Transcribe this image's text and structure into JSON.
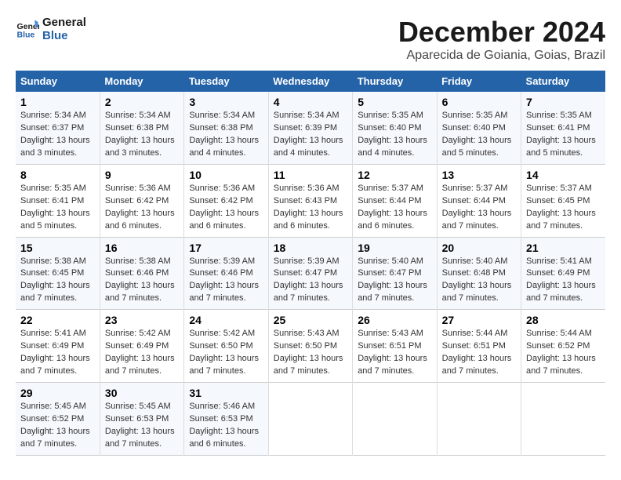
{
  "logo": {
    "line1": "General",
    "line2": "Blue"
  },
  "title": "December 2024",
  "subtitle": "Aparecida de Goiania, Goias, Brazil",
  "days_header": [
    "Sunday",
    "Monday",
    "Tuesday",
    "Wednesday",
    "Thursday",
    "Friday",
    "Saturday"
  ],
  "weeks": [
    [
      {
        "day": "1",
        "info": "Sunrise: 5:34 AM\nSunset: 6:37 PM\nDaylight: 13 hours\nand 3 minutes."
      },
      {
        "day": "2",
        "info": "Sunrise: 5:34 AM\nSunset: 6:38 PM\nDaylight: 13 hours\nand 3 minutes."
      },
      {
        "day": "3",
        "info": "Sunrise: 5:34 AM\nSunset: 6:38 PM\nDaylight: 13 hours\nand 4 minutes."
      },
      {
        "day": "4",
        "info": "Sunrise: 5:34 AM\nSunset: 6:39 PM\nDaylight: 13 hours\nand 4 minutes."
      },
      {
        "day": "5",
        "info": "Sunrise: 5:35 AM\nSunset: 6:40 PM\nDaylight: 13 hours\nand 4 minutes."
      },
      {
        "day": "6",
        "info": "Sunrise: 5:35 AM\nSunset: 6:40 PM\nDaylight: 13 hours\nand 5 minutes."
      },
      {
        "day": "7",
        "info": "Sunrise: 5:35 AM\nSunset: 6:41 PM\nDaylight: 13 hours\nand 5 minutes."
      }
    ],
    [
      {
        "day": "8",
        "info": "Sunrise: 5:35 AM\nSunset: 6:41 PM\nDaylight: 13 hours\nand 5 minutes."
      },
      {
        "day": "9",
        "info": "Sunrise: 5:36 AM\nSunset: 6:42 PM\nDaylight: 13 hours\nand 6 minutes."
      },
      {
        "day": "10",
        "info": "Sunrise: 5:36 AM\nSunset: 6:42 PM\nDaylight: 13 hours\nand 6 minutes."
      },
      {
        "day": "11",
        "info": "Sunrise: 5:36 AM\nSunset: 6:43 PM\nDaylight: 13 hours\nand 6 minutes."
      },
      {
        "day": "12",
        "info": "Sunrise: 5:37 AM\nSunset: 6:44 PM\nDaylight: 13 hours\nand 6 minutes."
      },
      {
        "day": "13",
        "info": "Sunrise: 5:37 AM\nSunset: 6:44 PM\nDaylight: 13 hours\nand 7 minutes."
      },
      {
        "day": "14",
        "info": "Sunrise: 5:37 AM\nSunset: 6:45 PM\nDaylight: 13 hours\nand 7 minutes."
      }
    ],
    [
      {
        "day": "15",
        "info": "Sunrise: 5:38 AM\nSunset: 6:45 PM\nDaylight: 13 hours\nand 7 minutes."
      },
      {
        "day": "16",
        "info": "Sunrise: 5:38 AM\nSunset: 6:46 PM\nDaylight: 13 hours\nand 7 minutes."
      },
      {
        "day": "17",
        "info": "Sunrise: 5:39 AM\nSunset: 6:46 PM\nDaylight: 13 hours\nand 7 minutes."
      },
      {
        "day": "18",
        "info": "Sunrise: 5:39 AM\nSunset: 6:47 PM\nDaylight: 13 hours\nand 7 minutes."
      },
      {
        "day": "19",
        "info": "Sunrise: 5:40 AM\nSunset: 6:47 PM\nDaylight: 13 hours\nand 7 minutes."
      },
      {
        "day": "20",
        "info": "Sunrise: 5:40 AM\nSunset: 6:48 PM\nDaylight: 13 hours\nand 7 minutes."
      },
      {
        "day": "21",
        "info": "Sunrise: 5:41 AM\nSunset: 6:49 PM\nDaylight: 13 hours\nand 7 minutes."
      }
    ],
    [
      {
        "day": "22",
        "info": "Sunrise: 5:41 AM\nSunset: 6:49 PM\nDaylight: 13 hours\nand 7 minutes."
      },
      {
        "day": "23",
        "info": "Sunrise: 5:42 AM\nSunset: 6:49 PM\nDaylight: 13 hours\nand 7 minutes."
      },
      {
        "day": "24",
        "info": "Sunrise: 5:42 AM\nSunset: 6:50 PM\nDaylight: 13 hours\nand 7 minutes."
      },
      {
        "day": "25",
        "info": "Sunrise: 5:43 AM\nSunset: 6:50 PM\nDaylight: 13 hours\nand 7 minutes."
      },
      {
        "day": "26",
        "info": "Sunrise: 5:43 AM\nSunset: 6:51 PM\nDaylight: 13 hours\nand 7 minutes."
      },
      {
        "day": "27",
        "info": "Sunrise: 5:44 AM\nSunset: 6:51 PM\nDaylight: 13 hours\nand 7 minutes."
      },
      {
        "day": "28",
        "info": "Sunrise: 5:44 AM\nSunset: 6:52 PM\nDaylight: 13 hours\nand 7 minutes."
      }
    ],
    [
      {
        "day": "29",
        "info": "Sunrise: 5:45 AM\nSunset: 6:52 PM\nDaylight: 13 hours\nand 7 minutes."
      },
      {
        "day": "30",
        "info": "Sunrise: 5:45 AM\nSunset: 6:53 PM\nDaylight: 13 hours\nand 7 minutes."
      },
      {
        "day": "31",
        "info": "Sunrise: 5:46 AM\nSunset: 6:53 PM\nDaylight: 13 hours\nand 6 minutes."
      },
      {
        "day": "",
        "info": ""
      },
      {
        "day": "",
        "info": ""
      },
      {
        "day": "",
        "info": ""
      },
      {
        "day": "",
        "info": ""
      }
    ]
  ]
}
